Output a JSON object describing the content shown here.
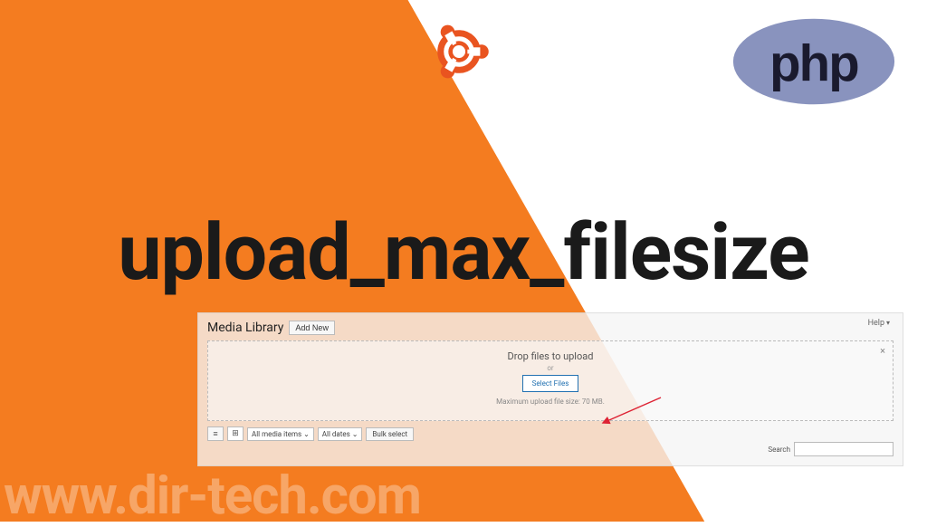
{
  "headline": "upload_max_filesize",
  "watermark": "www.dir-tech.com",
  "logos": {
    "ubuntu_name": "ubuntu-logo",
    "php_name": "php-logo",
    "php_text": "php"
  },
  "media_library": {
    "title": "Media Library",
    "add_new": "Add New",
    "help": "Help",
    "dropzone": {
      "title": "Drop files to upload",
      "or": "or",
      "select": "Select Files",
      "max_text": "Maximum upload file size: 70 MB.",
      "close": "×"
    },
    "toolbar": {
      "view_list": "≡",
      "view_grid": "⊞",
      "filter_items": "All media items",
      "filter_dates": "All dates",
      "bulk": "Bulk select",
      "search_label": "Search",
      "search_placeholder": ""
    }
  },
  "colors": {
    "orange": "#f47c20",
    "php_purple": "#8993be",
    "ubuntu_orange": "#E95420"
  }
}
